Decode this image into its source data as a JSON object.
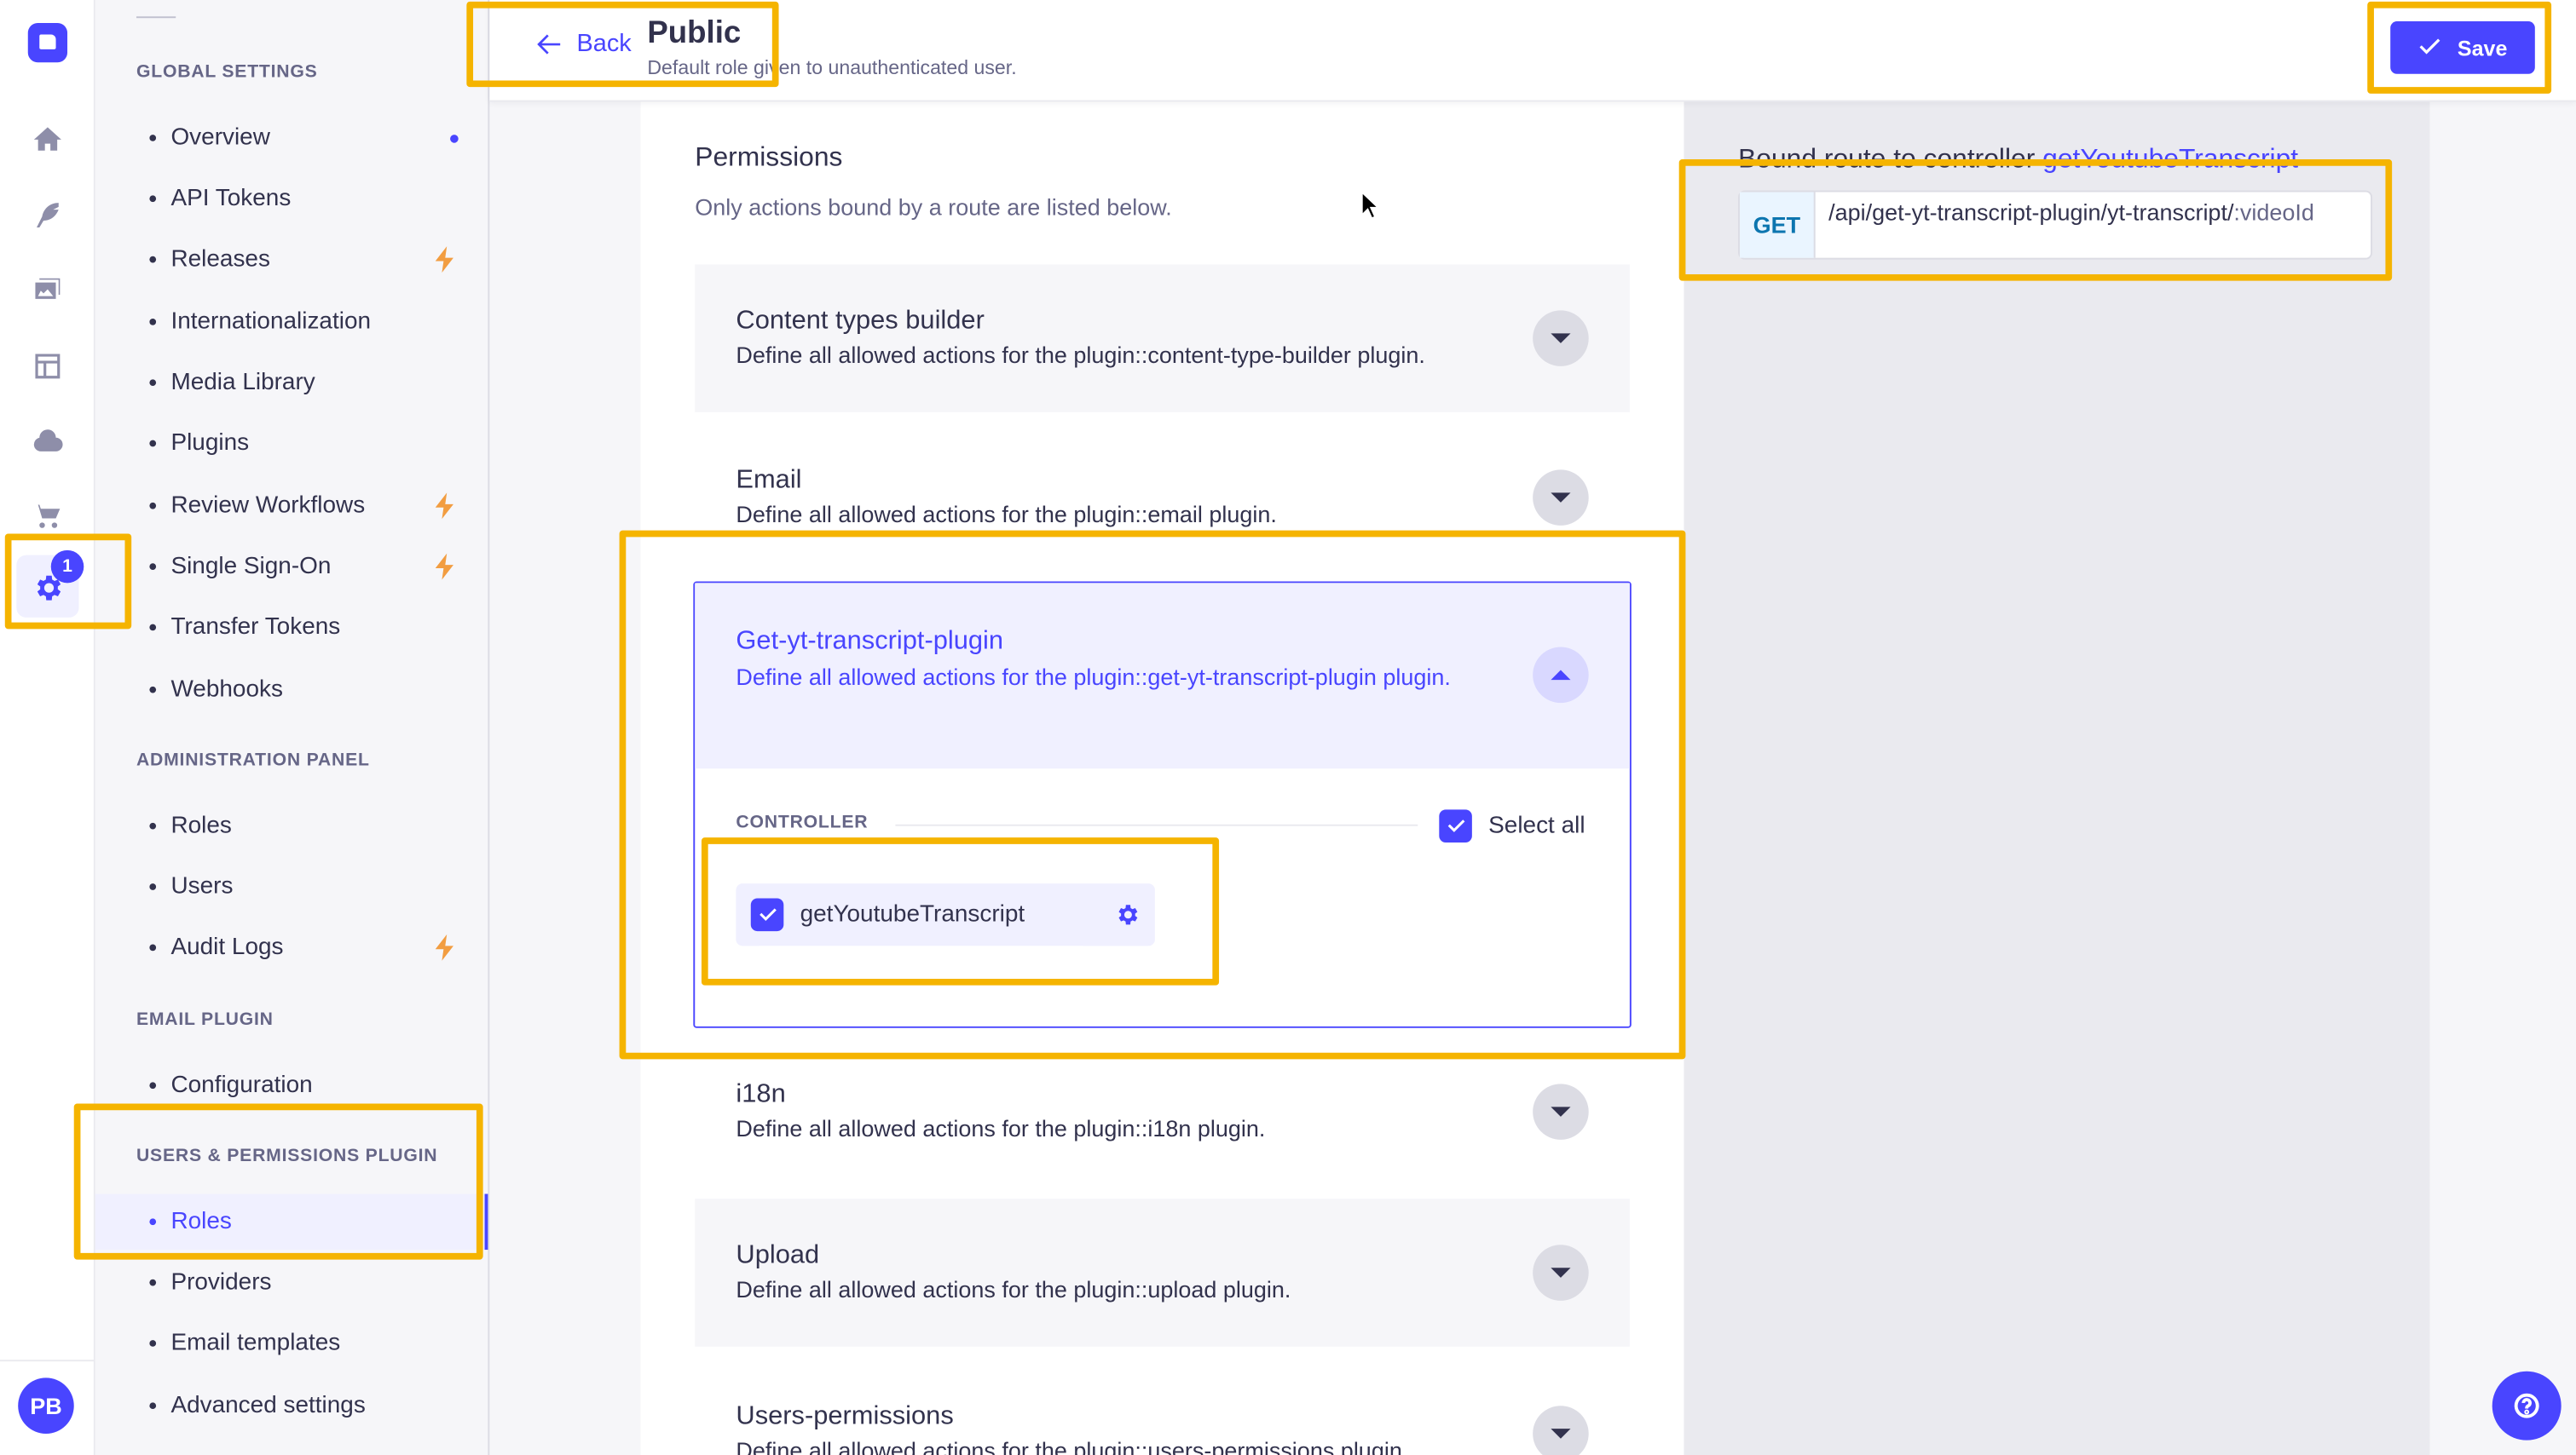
{
  "sidebar": {
    "sections": [
      {
        "title": "GLOBAL SETTINGS",
        "items": [
          {
            "label": "Overview",
            "marker": "new-dot"
          },
          {
            "label": "API Tokens"
          },
          {
            "label": "Releases",
            "marker": "bolt"
          },
          {
            "label": "Internationalization"
          },
          {
            "label": "Media Library"
          },
          {
            "label": "Plugins"
          },
          {
            "label": "Review Workflows",
            "marker": "bolt"
          },
          {
            "label": "Single Sign-On",
            "marker": "bolt"
          },
          {
            "label": "Transfer Tokens"
          },
          {
            "label": "Webhooks"
          }
        ]
      },
      {
        "title": "ADMINISTRATION PANEL",
        "items": [
          {
            "label": "Roles"
          },
          {
            "label": "Users"
          },
          {
            "label": "Audit Logs",
            "marker": "bolt"
          }
        ]
      },
      {
        "title": "EMAIL PLUGIN",
        "items": [
          {
            "label": "Configuration"
          }
        ]
      },
      {
        "title": "USERS & PERMISSIONS PLUGIN",
        "items": [
          {
            "label": "Roles",
            "active": true
          },
          {
            "label": "Providers"
          },
          {
            "label": "Email templates"
          },
          {
            "label": "Advanced settings"
          }
        ]
      }
    ]
  },
  "rail": {
    "badge": "1",
    "avatar_initials": "PB"
  },
  "header": {
    "back_label": "Back",
    "title": "Public",
    "subtitle": "Default role given to unauthenticated user.",
    "save_label": "Save"
  },
  "permissions": {
    "title": "Permissions",
    "subtitle": "Only actions bound by a route are listed below.",
    "accordions": [
      {
        "title": "Content types builder",
        "desc": "Define all allowed actions for the plugin::content-type-builder plugin."
      },
      {
        "title": "Email",
        "desc": "Define all allowed actions for the plugin::email plugin."
      },
      {
        "title": "Get-yt-transcript-plugin",
        "desc": "Define all allowed actions for the plugin::get-yt-transcript-plugin plugin.",
        "expanded": true
      },
      {
        "title": "i18n",
        "desc": "Define all allowed actions for the plugin::i18n plugin."
      },
      {
        "title": "Upload",
        "desc": "Define all allowed actions for the plugin::upload plugin."
      },
      {
        "title": "Users-permissions",
        "desc": "Define all allowed actions for the plugin::users-permissions plugin."
      }
    ],
    "controller_label": "CONTROLLER",
    "select_all_label": "Select all",
    "action_label": "getYoutubeTranscript"
  },
  "route": {
    "title_prefix": "Bound route to controller ",
    "title_controller": "getYoutubeTranscript",
    "method": "GET",
    "path": "/api/get-yt-transcript-plugin/yt-transcript/",
    "param": ":videoId"
  },
  "colors": {
    "primary": "#4945ff",
    "highlight": "#f5b400",
    "bolt": "#f29d41"
  }
}
